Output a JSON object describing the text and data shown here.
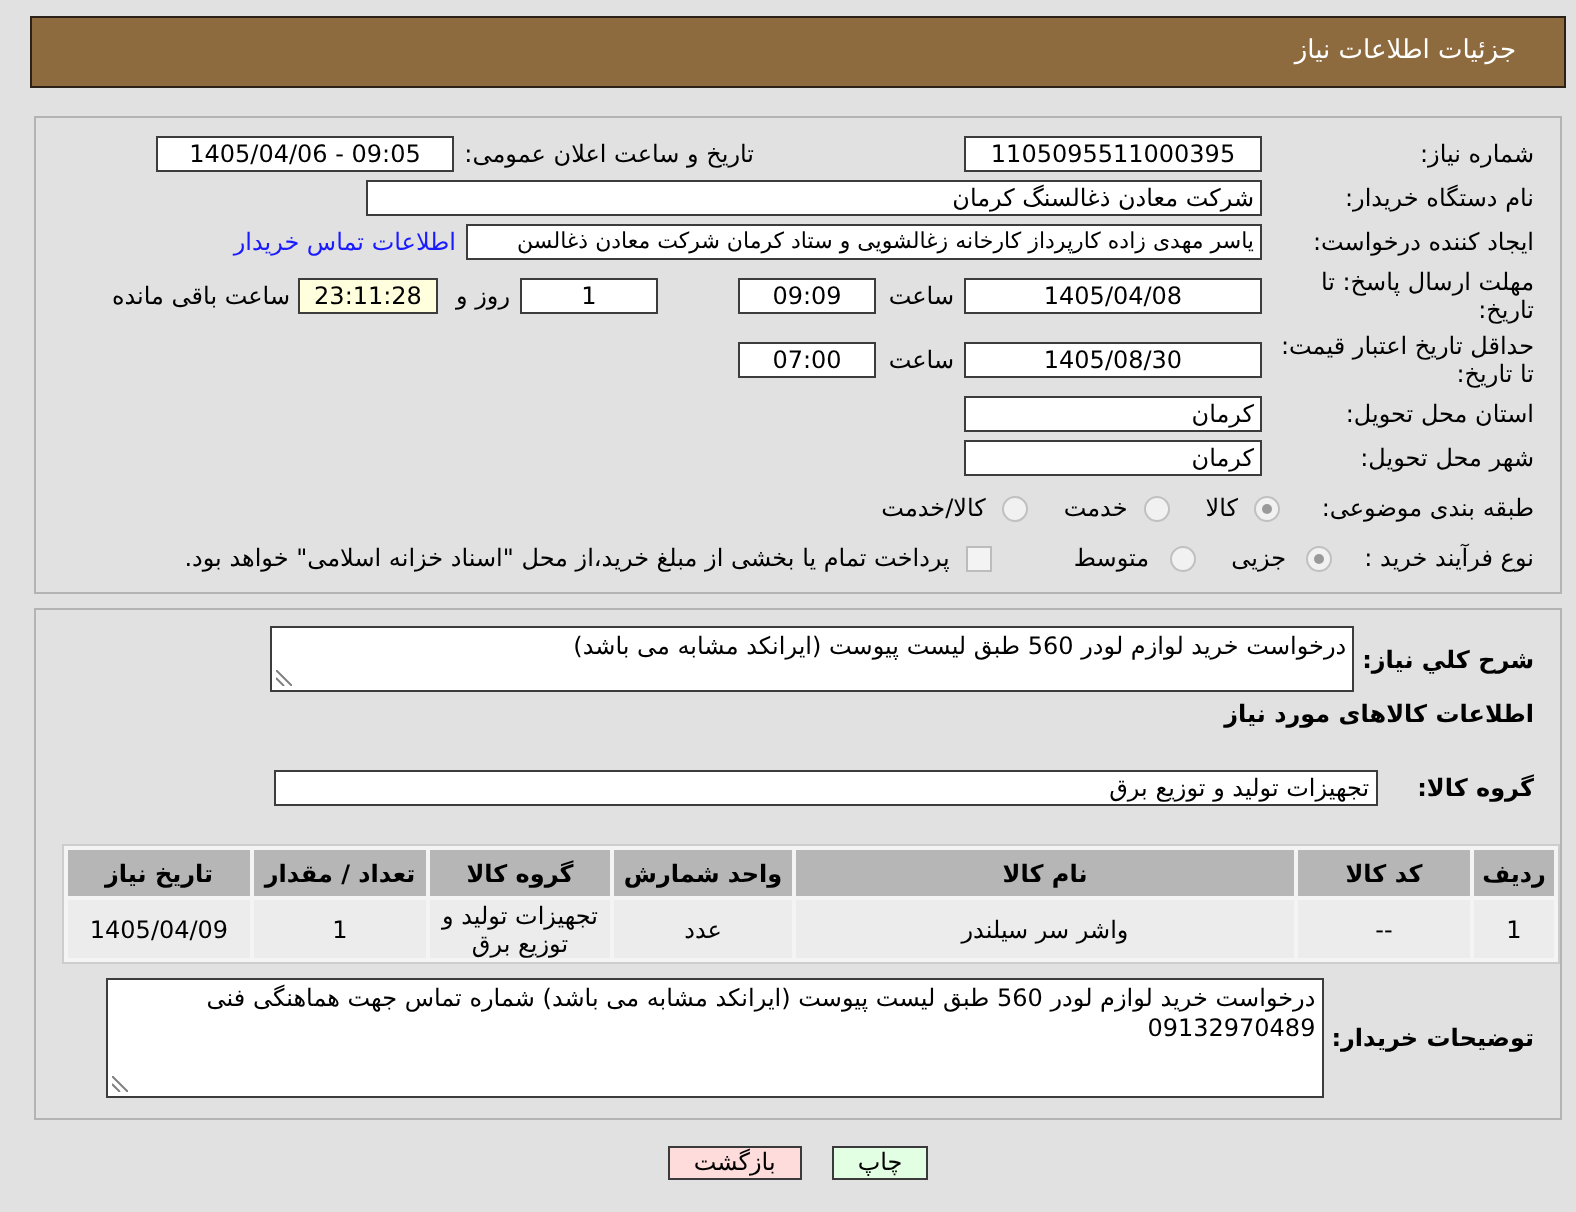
{
  "header": {
    "title": "جزئیات اطلاعات نیاز"
  },
  "need_info": {
    "need_number": {
      "label": "شماره نیاز:",
      "value": "1105095511000395"
    },
    "announce_datetime": {
      "label": "تاریخ و ساعت اعلان عمومی:",
      "value": "1405/04/06 - 09:05"
    },
    "buyer_org": {
      "label": "نام دستگاه خریدار:",
      "value": "شرکت معادن ذغالسنگ کرمان"
    },
    "requester": {
      "label": "ایجاد کننده درخواست:",
      "value": "یاسر مهدی زاده کارپرداز کارخانه زغالشویی و ستاد کرمان شرکت معادن ذغالسن",
      "contact_link": "اطلاعات تماس خریدار"
    },
    "reply_deadline": {
      "label": "مهلت ارسال پاسخ: تا تاریخ:",
      "date": "1405/04/08",
      "time_label": "ساعت",
      "time": "09:09",
      "days": "1",
      "days_label": "روز و",
      "remaining": "23:11:28",
      "remaining_label": "ساعت باقی مانده"
    },
    "price_validity": {
      "label": "حداقل تاریخ اعتبار قیمت: تا تاریخ:",
      "date": "1405/08/30",
      "time_label": "ساعت",
      "time": "07:00"
    },
    "delivery_province": {
      "label": "استان محل تحویل:",
      "value": "کرمان"
    },
    "delivery_city": {
      "label": "شهر محل تحویل:",
      "value": "کرمان"
    },
    "category": {
      "label": "طبقه بندی موضوعی:",
      "disabled": true,
      "options": [
        {
          "label": "کالا",
          "selected": true
        },
        {
          "label": "خدمت",
          "selected": false
        },
        {
          "label": "کالا/خدمت",
          "selected": false
        }
      ]
    },
    "purchase_process": {
      "label": "نوع فرآیند خرید :",
      "disabled": true,
      "options": [
        {
          "label": "جزیی",
          "selected": true
        },
        {
          "label": "متوسط",
          "selected": false
        }
      ],
      "treasury_payment": {
        "label": "پرداخت تمام یا بخشی از مبلغ خرید،از محل \"اسناد خزانه اسلامی\" خواهد بود.",
        "checked": false
      }
    }
  },
  "description": {
    "label": "شرح کلي نياز:",
    "value": "درخواست خرید لوازم لودر 560 طبق لیست پیوست (ایرانکد مشابه می باشد)"
  },
  "goods": {
    "title": "اطلاعات کالاهای مورد نیاز",
    "group": {
      "label": "گروه کالا:",
      "value": "تجهیزات تولید و توزیع برق"
    },
    "table": {
      "columns": [
        "ردیف",
        "کد کالا",
        "نام کالا",
        "واحد شمارش",
        "گروه کالا",
        "تعداد / مقدار",
        "تاریخ نیاز"
      ],
      "rows": [
        [
          "1",
          "--",
          "واشر سر سیلندر",
          "عدد",
          "تجهیزات تولید و توزیع برق",
          "1",
          "1405/04/09"
        ]
      ]
    }
  },
  "buyer_notes": {
    "label": "توضیحات خریدار:",
    "value": "درخواست خرید لوازم لودر 560 طبق لیست پیوست (ایرانکد مشابه می باشد) شماره تماس جهت هماهنگی فنی 09132970489"
  },
  "buttons": [
    {
      "label": "چاپ",
      "kind": "print"
    },
    {
      "label": "بازگشت",
      "kind": "back"
    }
  ]
}
